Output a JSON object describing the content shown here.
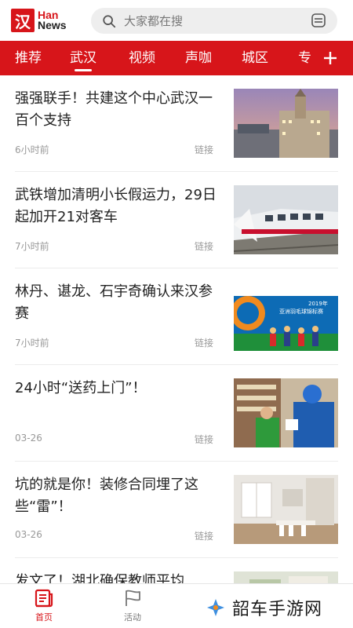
{
  "header": {
    "logo_mark": "汉",
    "logo_line1": "Han",
    "logo_line2": "News",
    "search_placeholder": "大家都在搜"
  },
  "nav": {
    "items": [
      {
        "label": "推荐",
        "active": false
      },
      {
        "label": "武汉",
        "active": true
      },
      {
        "label": "视频",
        "active": false
      },
      {
        "label": "声咖",
        "active": false
      },
      {
        "label": "城区",
        "active": false
      },
      {
        "label": "专",
        "active": false
      }
    ],
    "add_icon": "plus-icon"
  },
  "articles": [
    {
      "title": "强强联手！共建这个中心武汉一百个支持",
      "time": "6小时前",
      "source": "链接",
      "image": "wuhan-customs-house-photo"
    },
    {
      "title": "武铁增加清明小长假运力，29日起加开21对客车",
      "time": "7小时前",
      "source": "链接",
      "image": "high-speed-train-photo"
    },
    {
      "title": "林丹、谌龙、石宇奇确认来汉参赛",
      "time": "7小时前",
      "source": "链接",
      "image": "badminton-poster-photo"
    },
    {
      "title": "24小时“送药上门”！",
      "time": "03-26",
      "source": "链接",
      "image": "medicine-delivery-photo"
    },
    {
      "title": "坑的就是你！装修合同埋了这些“雷”！",
      "time": "03-26",
      "source": "链接",
      "image": "interior-room-photo"
    },
    {
      "title": "发文了！湖北确保教师平均",
      "time": "",
      "source": "",
      "image": "partial-photo"
    }
  ],
  "poster": {
    "year": "2019年",
    "name": "亚洲羽毛球锦标赛"
  },
  "bottom_bar": {
    "tabs": [
      {
        "label": "首页",
        "active": true,
        "icon": "newspaper-icon"
      },
      {
        "label": "活动",
        "active": false,
        "icon": "flag-icon"
      }
    ]
  },
  "watermark": {
    "text": "韶车手游网",
    "icon": "cross-logo-icon"
  },
  "colors": {
    "brand_red": "#d7151a",
    "text_dark": "#222222",
    "text_muted": "#999999"
  }
}
